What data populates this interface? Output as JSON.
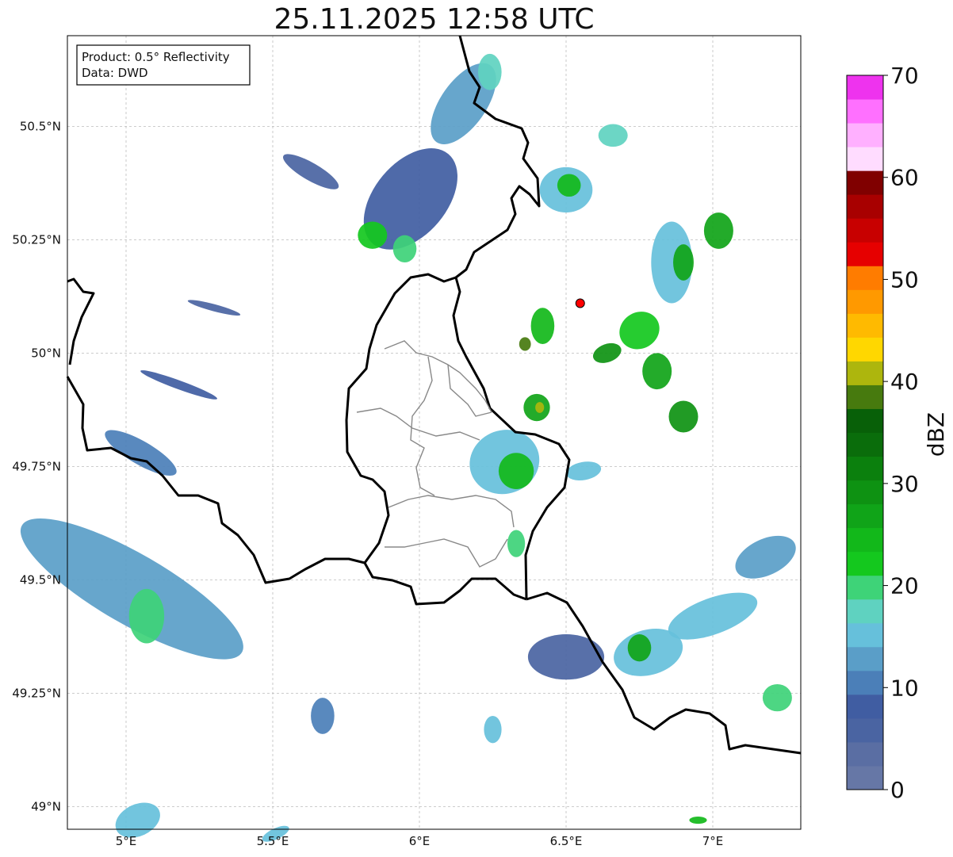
{
  "title": "25.11.2025 12:58 UTC",
  "info_box": {
    "line1": "Product: 0.5° Reflectivity",
    "line2": "Data: DWD"
  },
  "map": {
    "extent": {
      "lon_min": 4.8,
      "lon_max": 7.3,
      "lat_min": 48.95,
      "lat_max": 50.7
    },
    "lon_ticks": [
      {
        "value": 5.0,
        "label": "5°E"
      },
      {
        "value": 5.5,
        "label": "5.5°E"
      },
      {
        "value": 6.0,
        "label": "6°E"
      },
      {
        "value": 6.5,
        "label": "6.5°E"
      },
      {
        "value": 7.0,
        "label": "7°E"
      }
    ],
    "lat_ticks": [
      {
        "value": 49.0,
        "label": "49°N"
      },
      {
        "value": 49.25,
        "label": "49.25°N"
      },
      {
        "value": 49.5,
        "label": "49.5°N"
      },
      {
        "value": 49.75,
        "label": "49.75°N"
      },
      {
        "value": 50.0,
        "label": "50°N"
      },
      {
        "value": 50.25,
        "label": "50.25°N"
      },
      {
        "value": 50.5,
        "label": "50.5°N"
      }
    ],
    "grid": true,
    "radar_site": {
      "lon": 6.548,
      "lat": 50.11,
      "color": "#ff0000"
    },
    "precip_cells": [
      {
        "lon": 5.02,
        "lat": 49.48,
        "rlon": 0.12,
        "rlat": 0.28,
        "angle": -60,
        "dbz": 12
      },
      {
        "lon": 5.07,
        "lat": 49.42,
        "rlon": 0.06,
        "rlat": 0.06,
        "angle": 0,
        "dbz": 20
      },
      {
        "lon": 5.05,
        "lat": 49.78,
        "rlon": 0.04,
        "rlat": 0.09,
        "angle": -60,
        "dbz": 10
      },
      {
        "lon": 5.18,
        "lat": 49.93,
        "rlon": 0.015,
        "rlat": 0.09,
        "angle": -70,
        "dbz": 8
      },
      {
        "lon": 5.3,
        "lat": 50.1,
        "rlon": 0.012,
        "rlat": 0.06,
        "angle": -75,
        "dbz": 6
      },
      {
        "lon": 5.04,
        "lat": 48.97,
        "rlon": 0.08,
        "rlat": 0.035,
        "angle": -25,
        "dbz": 14
      },
      {
        "lon": 5.67,
        "lat": 49.2,
        "rlon": 0.04,
        "rlat": 0.04,
        "angle": 0,
        "dbz": 10
      },
      {
        "lon": 5.97,
        "lat": 50.34,
        "rlon": 0.2,
        "rlat": 0.08,
        "angle": -50,
        "dbz": 8
      },
      {
        "lon": 5.84,
        "lat": 50.26,
        "rlon": 0.05,
        "rlat": 0.03,
        "angle": 0,
        "dbz": 22
      },
      {
        "lon": 5.95,
        "lat": 50.23,
        "rlon": 0.04,
        "rlat": 0.03,
        "angle": 0,
        "dbz": 20
      },
      {
        "lon": 5.63,
        "lat": 50.4,
        "rlon": 0.03,
        "rlat": 0.07,
        "angle": -60,
        "dbz": 6
      },
      {
        "lon": 6.15,
        "lat": 50.55,
        "rlon": 0.16,
        "rlat": 0.05,
        "angle": -55,
        "dbz": 12
      },
      {
        "lon": 6.24,
        "lat": 50.62,
        "rlon": 0.04,
        "rlat": 0.04,
        "angle": 0,
        "dbz": 18
      },
      {
        "lon": 6.5,
        "lat": 50.36,
        "rlon": 0.09,
        "rlat": 0.05,
        "angle": 0,
        "dbz": 14
      },
      {
        "lon": 6.51,
        "lat": 50.37,
        "rlon": 0.04,
        "rlat": 0.025,
        "angle": 0,
        "dbz": 24
      },
      {
        "lon": 6.66,
        "lat": 50.48,
        "rlon": 0.05,
        "rlat": 0.025,
        "angle": 0,
        "dbz": 18
      },
      {
        "lon": 6.86,
        "lat": 50.2,
        "rlon": 0.07,
        "rlat": 0.09,
        "angle": 0,
        "dbz": 16
      },
      {
        "lon": 6.9,
        "lat": 50.2,
        "rlon": 0.035,
        "rlat": 0.04,
        "angle": 0,
        "dbz": 26
      },
      {
        "lon": 7.02,
        "lat": 50.27,
        "rlon": 0.05,
        "rlat": 0.04,
        "angle": 0,
        "dbz": 26
      },
      {
        "lon": 6.75,
        "lat": 50.05,
        "rlon": 0.07,
        "rlat": 0.04,
        "angle": -30,
        "dbz": 22
      },
      {
        "lon": 6.64,
        "lat": 50.0,
        "rlon": 0.05,
        "rlat": 0.02,
        "angle": -20,
        "dbz": 28
      },
      {
        "lon": 6.81,
        "lat": 49.96,
        "rlon": 0.05,
        "rlat": 0.04,
        "angle": 0,
        "dbz": 26
      },
      {
        "lon": 6.9,
        "lat": 49.86,
        "rlon": 0.05,
        "rlat": 0.035,
        "angle": 0,
        "dbz": 28
      },
      {
        "lon": 6.42,
        "lat": 50.06,
        "rlon": 0.04,
        "rlat": 0.04,
        "angle": 0,
        "dbz": 24
      },
      {
        "lon": 6.36,
        "lat": 50.02,
        "rlon": 0.02,
        "rlat": 0.015,
        "angle": 0,
        "dbz": 38
      },
      {
        "lon": 6.4,
        "lat": 49.88,
        "rlon": 0.045,
        "rlat": 0.03,
        "angle": 0,
        "dbz": 26
      },
      {
        "lon": 6.41,
        "lat": 49.88,
        "rlon": 0.015,
        "rlat": 0.012,
        "angle": 0,
        "dbz": 40
      },
      {
        "lon": 6.29,
        "lat": 49.76,
        "rlon": 0.12,
        "rlat": 0.07,
        "angle": -20,
        "dbz": 16
      },
      {
        "lon": 6.33,
        "lat": 49.74,
        "rlon": 0.06,
        "rlat": 0.04,
        "angle": 0,
        "dbz": 24
      },
      {
        "lon": 6.56,
        "lat": 49.74,
        "rlon": 0.06,
        "rlat": 0.02,
        "angle": -10,
        "dbz": 14
      },
      {
        "lon": 6.5,
        "lat": 49.33,
        "rlon": 0.13,
        "rlat": 0.05,
        "angle": 0,
        "dbz": 6
      },
      {
        "lon": 6.78,
        "lat": 49.34,
        "rlon": 0.12,
        "rlat": 0.05,
        "angle": -15,
        "dbz": 16
      },
      {
        "lon": 6.75,
        "lat": 49.35,
        "rlon": 0.04,
        "rlat": 0.03,
        "angle": 0,
        "dbz": 26
      },
      {
        "lon": 7.0,
        "lat": 49.42,
        "rlon": 0.16,
        "rlat": 0.04,
        "angle": -20,
        "dbz": 14
      },
      {
        "lon": 7.18,
        "lat": 49.55,
        "rlon": 0.11,
        "rlat": 0.04,
        "angle": -25,
        "dbz": 12
      },
      {
        "lon": 7.22,
        "lat": 49.24,
        "rlon": 0.05,
        "rlat": 0.03,
        "angle": 0,
        "dbz": 20
      },
      {
        "lon": 6.25,
        "lat": 49.17,
        "rlon": 0.03,
        "rlat": 0.03,
        "angle": 0,
        "dbz": 14
      },
      {
        "lon": 6.33,
        "lat": 49.58,
        "rlon": 0.03,
        "rlat": 0.03,
        "angle": 0,
        "dbz": 20
      },
      {
        "lon": 5.51,
        "lat": 48.94,
        "rlon": 0.05,
        "rlat": 0.012,
        "angle": -25,
        "dbz": 14
      },
      {
        "lon": 6.95,
        "lat": 48.97,
        "rlon": 0.03,
        "rlat": 0.008,
        "angle": 0,
        "dbz": 24
      }
    ]
  },
  "colorbar": {
    "label": "dBZ",
    "min": 0,
    "max": 70,
    "tick_values": [
      0,
      10,
      20,
      30,
      40,
      50,
      60,
      70
    ],
    "tick_labels": [
      "0",
      "10",
      "20",
      "30",
      "40",
      "50",
      "60",
      "70"
    ],
    "colors": [
      "#6677a6",
      "#5a6ea3",
      "#4a64a2",
      "#405da2",
      "#4b7fb8",
      "#5a9ec8",
      "#66c0db",
      "#5fd2c0",
      "#3ed378",
      "#14c81e",
      "#12b81a",
      "#10a418",
      "#0e9212",
      "#0b800d",
      "#0a6d0b",
      "#086008",
      "#477a0e",
      "#adb60d",
      "#ffd700",
      "#ffba00",
      "#ff9900",
      "#ff7c00",
      "#e60000",
      "#c80000",
      "#a80000",
      "#800000",
      "#ffdcff",
      "#ffb0ff",
      "#ff70ff",
      "#ee33ee"
    ]
  }
}
